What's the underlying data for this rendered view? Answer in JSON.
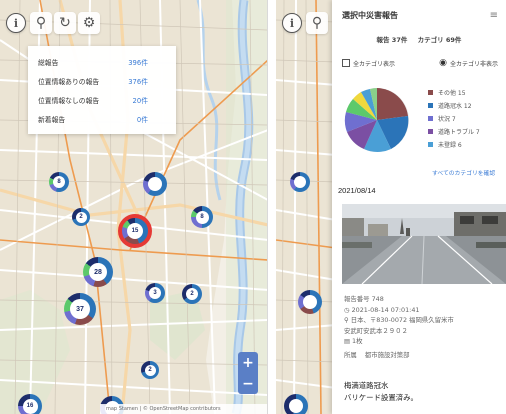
{
  "left_screen": {
    "toolbar": {
      "info_icon": "i",
      "search_icon": "⚲",
      "refresh_icon": "↻",
      "settings_icon": "⚙"
    },
    "stats": [
      {
        "label": "総報告",
        "count": "396件"
      },
      {
        "label": "位置情報ありの報告",
        "count": "376件"
      },
      {
        "label": "位置情報なしの報告",
        "count": "20件"
      },
      {
        "label": "新着報告",
        "count": "0件"
      }
    ],
    "clusters": [
      {
        "label": "8"
      },
      {
        "label": ""
      },
      {
        "label": "2"
      },
      {
        "label": "15"
      },
      {
        "label": "8"
      },
      {
        "label": "28"
      },
      {
        "label": "37"
      },
      {
        "label": "3"
      },
      {
        "label": "2"
      },
      {
        "label": "2"
      },
      {
        "label": "16"
      }
    ],
    "zoom": {
      "in": "+",
      "out": "−"
    },
    "attribution": "map Stamen | © OpenStreetMap contributors"
  },
  "right_screen": {
    "toolbar": {
      "info_icon": "i",
      "search_icon": "⚲"
    },
    "detail_title": "選択中災害報告",
    "filter_icon": "≡",
    "summary": {
      "reports": "報告 37件",
      "categories": "カテゴリ 69件"
    },
    "toggles": {
      "show_all": "全カテゴリ表示",
      "hide_all": "全カテゴリ非表示"
    },
    "legend": [
      {
        "label": "その他 15",
        "color": "#8a4b4b"
      },
      {
        "label": "道路冠水 12",
        "color": "#2b74b8"
      },
      {
        "label": "状況 7",
        "color": "#6f6fd0"
      },
      {
        "label": "道路トラブル 7",
        "color": "#7b4fa3"
      },
      {
        "label": "未登録 6",
        "color": "#4a9fd6"
      }
    ],
    "see_all_link": "すべてのカテゴリを確認",
    "date": "2021/08/14",
    "report": {
      "number": "報告番号 748",
      "time": "2021-08-14 07:01:41",
      "address_line1": "日本、〒830-0072 福岡県久留米市",
      "address_line2": "安武町安武本２９０２",
      "photo_count": "1枚",
      "dept_label": "所属",
      "dept_value": "都市施設対策部"
    },
    "summary_text": {
      "line1": "梅満道路冠水",
      "line2": "バリケード設置済み。"
    }
  }
}
